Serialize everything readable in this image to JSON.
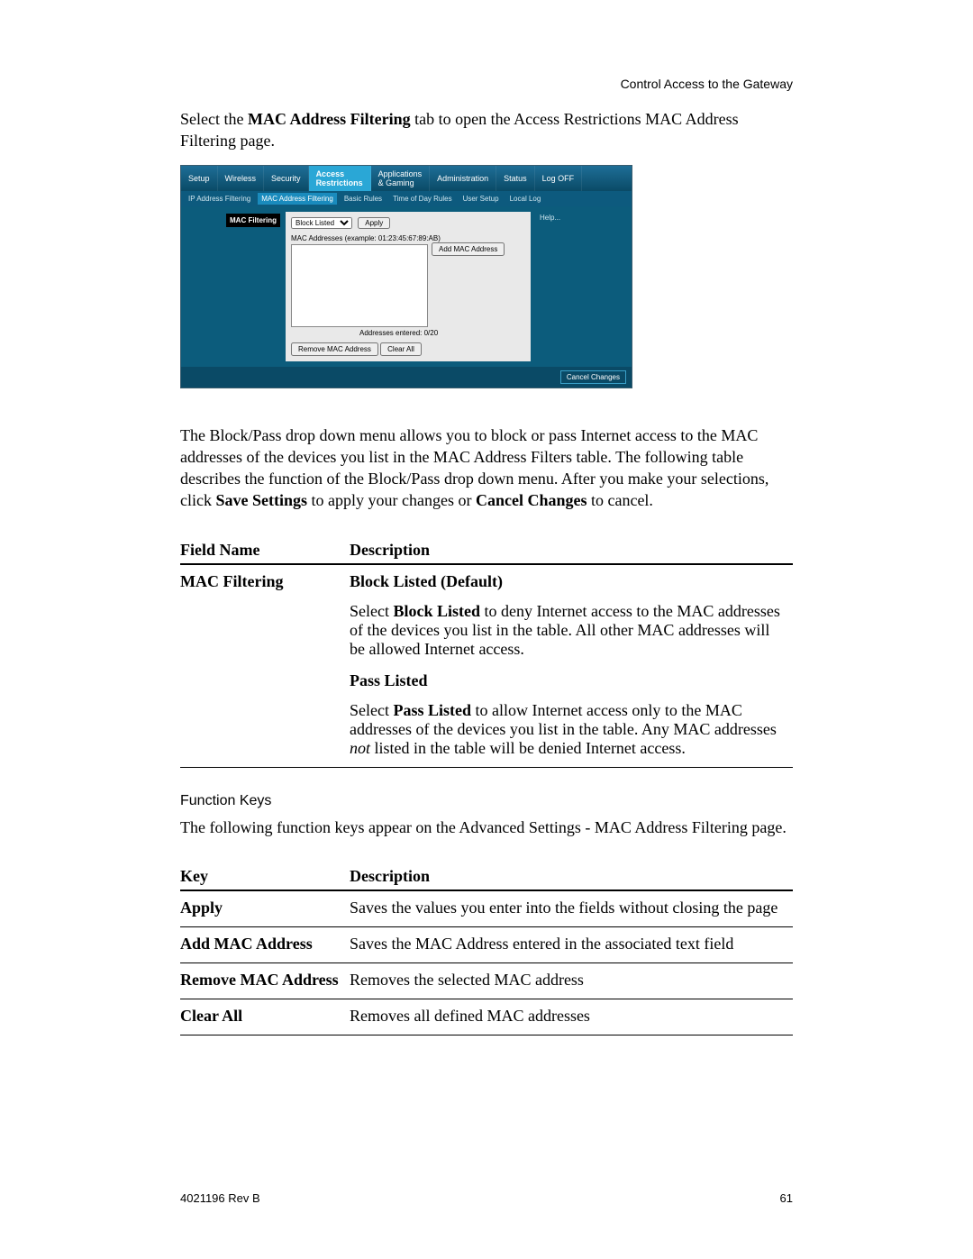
{
  "header": {
    "right": "Control Access to the Gateway"
  },
  "intro": {
    "pre": "Select the ",
    "bold": "MAC Address Filtering",
    "post": " tab to open the Access Restrictions MAC Address Filtering page."
  },
  "screenshot": {
    "topnav": [
      "Setup",
      "Wireless",
      "Security",
      "Access Restrictions",
      "Applications & Gaming",
      "Administration",
      "Status",
      "Log OFF"
    ],
    "topnav_active_index": 3,
    "subnav": [
      "IP Address Filtering",
      "MAC Address Filtering",
      "Basic Rules",
      "Time of Day Rules",
      "User Setup",
      "Local Log"
    ],
    "subnav_active_index": 1,
    "left_label": "MAC Filtering",
    "select_value": "Block Listed",
    "apply_label": "Apply",
    "example_line": "MAC Addresses (example: 01:23:45:67:89:AB)",
    "add_btn": "Add MAC Address",
    "entered": "Addresses entered: 0/20",
    "remove_btn": "Remove MAC Address",
    "clear_btn": "Clear All",
    "help_label": "Help...",
    "cancel_btn": "Cancel Changes"
  },
  "para2": {
    "p1": "The Block/Pass drop down menu allows you to block or pass Internet access to the MAC addresses of the devices you list in the MAC Address Filters table. The following table describes the function of the Block/Pass drop down menu. After you make your selections, click ",
    "b1": "Save Settings",
    "mid": " to apply your changes or ",
    "b2": "Cancel Changes",
    "end": " to cancel."
  },
  "table1": {
    "head": [
      "Field Name",
      "Description"
    ],
    "row_field": "MAC Filtering",
    "block_title": "Block Listed (Default)",
    "block_body_pre": "Select ",
    "block_body_bold": "Block Listed",
    "block_body_post": " to deny Internet access to the MAC addresses of the devices you list in the table. All other MAC addresses will be allowed Internet access.",
    "pass_title": "Pass Listed",
    "pass_body_pre": "Select ",
    "pass_body_bold": "Pass Listed",
    "pass_body_mid": " to allow Internet access only to the MAC addresses of the devices you list in the table. Any MAC addresses ",
    "pass_body_ital": "not",
    "pass_body_post": " listed in the table will be denied Internet access."
  },
  "fk_heading": "Function Keys",
  "fk_para": "The following function keys appear on the Advanced Settings - MAC Address Filtering page.",
  "table2": {
    "head": [
      "Key",
      "Description"
    ],
    "rows": [
      {
        "k": "Apply",
        "d": "Saves the values you enter into the fields without closing the page"
      },
      {
        "k": "Add MAC Address",
        "d": "Saves the MAC Address entered in the associated text field"
      },
      {
        "k": "Remove MAC Address",
        "d": "Removes the selected MAC address"
      },
      {
        "k": "Clear All",
        "d": "Removes all defined MAC addresses"
      }
    ]
  },
  "footer": {
    "left": "4021196 Rev B",
    "right": "61"
  }
}
